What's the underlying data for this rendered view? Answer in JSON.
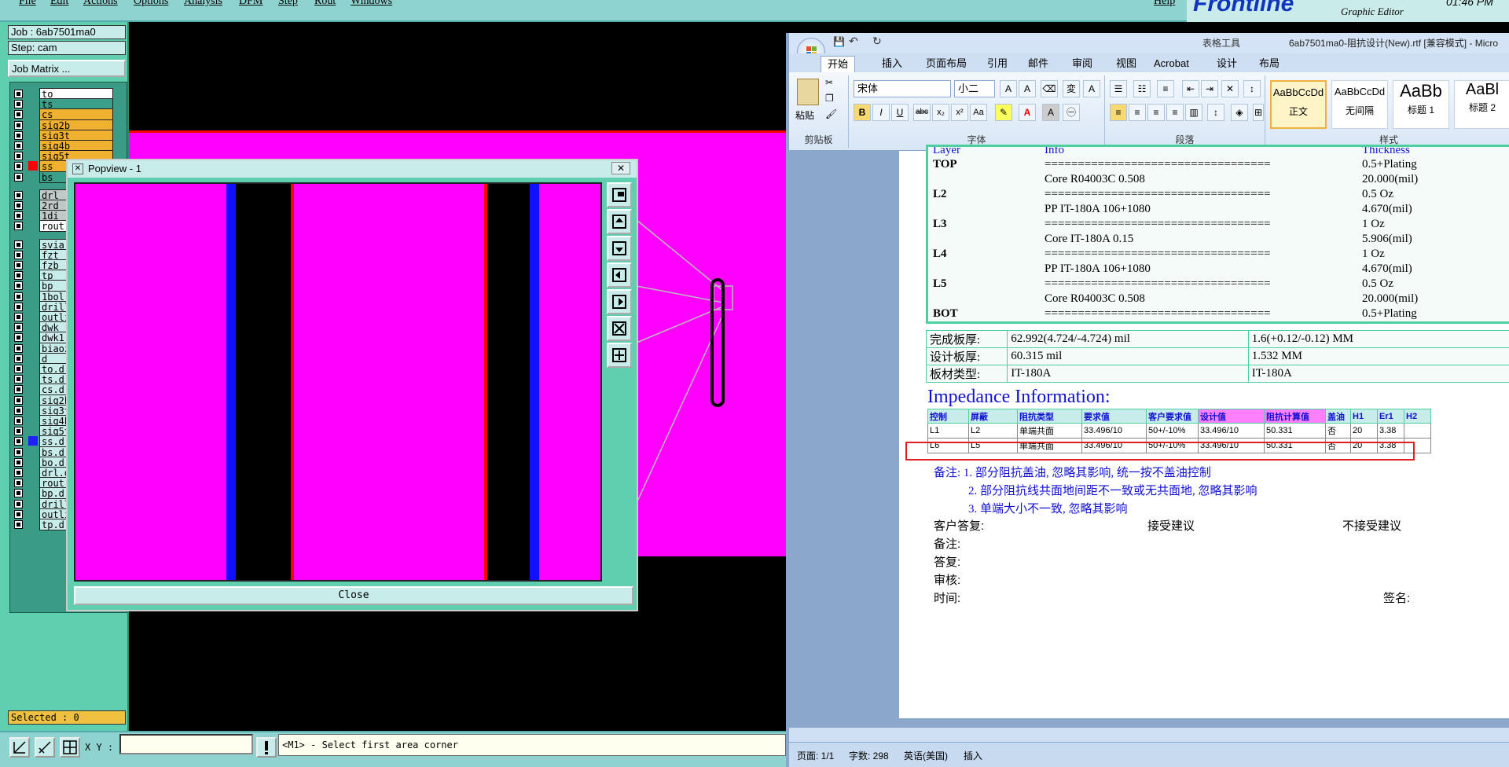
{
  "genesis": {
    "menu": [
      "File",
      "Edit",
      "Actions",
      "Options",
      "Analysis",
      "DFM",
      "Step",
      "Rout",
      "Windows",
      "Help"
    ],
    "job": "Job : 6ab7501ma0",
    "step": "Step: cam",
    "job_matrix": "Job Matrix ...",
    "layers": [
      {
        "name": "to",
        "color": "#ffffff"
      },
      {
        "name": "ts",
        "color": "#3aa08a"
      },
      {
        "name": "cs",
        "color": "#f0b030"
      },
      {
        "name": "sig2b",
        "color": "#f0b030"
      },
      {
        "name": "sig3t",
        "color": "#f0b030"
      },
      {
        "name": "sig4b",
        "color": "#f0b030"
      },
      {
        "name": "sig5t",
        "color": "#f0b030"
      },
      {
        "name": "ss",
        "color": "#f0b030",
        "swatch": "#ff0000"
      },
      {
        "name": "bs",
        "color": "#3aa08a"
      },
      {
        "name": "drl",
        "color": "#c0c8c8"
      },
      {
        "name": "2rd",
        "color": "#c0c8c8"
      },
      {
        "name": "1di",
        "color": "#c0c8c8"
      },
      {
        "name": "rout",
        "color": "#ffffff"
      },
      {
        "name": "svia",
        "color": "#c7ecea"
      },
      {
        "name": "fzt",
        "color": "#c7ecea"
      },
      {
        "name": "fzb",
        "color": "#c7ecea"
      },
      {
        "name": "tp",
        "color": "#c7ecea"
      },
      {
        "name": "bp",
        "color": "#c7ecea"
      },
      {
        "name": "1bol",
        "color": "#c7ecea"
      },
      {
        "name": "drill",
        "color": "#c7ecea"
      },
      {
        "name": "outli",
        "color": "#c7ecea"
      },
      {
        "name": "dwk",
        "color": "#c7ecea"
      },
      {
        "name": "dwk1",
        "color": "#c7ecea"
      },
      {
        "name": "biaoz",
        "color": "#c7ecea"
      },
      {
        "name": "d",
        "color": "#c7ecea"
      },
      {
        "name": "to.d",
        "color": "#c7ecea"
      },
      {
        "name": "ts.d",
        "color": "#c7ecea"
      },
      {
        "name": "cs.d",
        "color": "#c7ecea"
      },
      {
        "name": "sig2b",
        "color": "#c7ecea"
      },
      {
        "name": "sig3t",
        "color": "#c7ecea"
      },
      {
        "name": "sig4b",
        "color": "#c7ecea"
      },
      {
        "name": "sig5t",
        "color": "#c7ecea"
      },
      {
        "name": "ss.d",
        "color": "#c7ecea",
        "swatch": "#2020ff"
      },
      {
        "name": "bs.d",
        "color": "#c7ecea"
      },
      {
        "name": "bo.d",
        "color": "#c7ecea"
      },
      {
        "name": "drl.d",
        "color": "#c7ecea"
      },
      {
        "name": "rout.",
        "color": "#c7ecea"
      },
      {
        "name": "bp.d",
        "color": "#c7ecea"
      },
      {
        "name": "drill",
        "color": "#c7ecea"
      },
      {
        "name": "outli",
        "color": "#c7ecea"
      },
      {
        "name": "tp.d",
        "color": "#c7ecea"
      }
    ],
    "selected": "Selected : 0",
    "xy_label": "X Y :",
    "message": "<M1> - Select first area corner",
    "popview_title": "Popview - 1",
    "popview_close": "Close"
  },
  "frontline": {
    "logo": "Frontline",
    "subtitle": "Graphic Editor",
    "time": "01:46 PM"
  },
  "word": {
    "title": "6ab7501ma0-阻抗设计(New).rtf [兼容模式] - Micro",
    "context_tab": "表格工具",
    "tabs": [
      "开始",
      "插入",
      "页面布局",
      "引用",
      "邮件",
      "审阅",
      "视图",
      "Acrobat",
      "设计",
      "布局"
    ],
    "font_name": "宋体",
    "font_size": "小二",
    "paste_label": "粘贴",
    "groups": [
      "剪贴板",
      "字体",
      "段落",
      "样式"
    ],
    "styles": [
      {
        "preview": "AaBbCcDd",
        "label": "正文"
      },
      {
        "preview": "AaBbCcDd",
        "label": "无间隔"
      },
      {
        "preview": "AaBb",
        "label": "标题 1"
      },
      {
        "preview": "AaBl",
        "label": "标题 2"
      }
    ],
    "stack": {
      "header": [
        "Layer",
        "Info",
        "Thickness"
      ],
      "rows": [
        [
          "TOP",
          "==================================",
          "0.5+Plating"
        ],
        [
          "",
          "Core      R04003C    0.508",
          "20.000(mil)"
        ],
        [
          "L2",
          "==================================",
          "0.5 Oz"
        ],
        [
          "",
          "PP      IT-180A    106+1080",
          "4.670(mil)"
        ],
        [
          "L3",
          "==================================",
          "1 Oz"
        ],
        [
          "",
          "Core      IT-180A    0.15",
          "5.906(mil)"
        ],
        [
          "L4",
          "==================================",
          "1 Oz"
        ],
        [
          "",
          "PP      IT-180A    106+1080",
          "4.670(mil)"
        ],
        [
          "L5",
          "==================================",
          "0.5 Oz"
        ],
        [
          "",
          "Core      R04003C    0.508",
          "20.000(mil)"
        ],
        [
          "BOT",
          "==================================",
          "0.5+Plating"
        ]
      ]
    },
    "thickness": [
      [
        "完成板厚:",
        "62.992(4.724/-4.724) mil",
        "1.6(+0.12/-0.12) MM"
      ],
      [
        "设计板厚:",
        "60.315 mil",
        "1.532 MM"
      ],
      [
        "板材类型:",
        "IT-180A",
        "IT-180A"
      ]
    ],
    "impedance_title": "Impedance Information:",
    "imp_header": [
      "控制",
      "屏蔽",
      "阻抗类型",
      "要求值",
      "客户要求值",
      "设计值",
      "阻抗计算值",
      "盖油",
      "H1",
      "Er1",
      "H2"
    ],
    "imp_rows": [
      [
        "L1",
        "L2",
        "单端共面",
        "33.496/10",
        "50+/-10%",
        "33.496/10",
        "50.331",
        "否",
        "20",
        "3.38",
        ""
      ],
      [
        "L6",
        "L5",
        "单端共面",
        "33.496/10",
        "50+/-10%",
        "33.496/10",
        "50.331",
        "否",
        "20",
        "3.38",
        ""
      ]
    ],
    "notes": [
      "备注: 1. 部分阻抗盖油, 忽略其影响, 统一按不盖油控制",
      "2. 部分阻抗线共面地间距不一致或无共面地, 忽略其影响",
      "3. 单端大小不一致, 忽略其影响"
    ],
    "customer_reply": "客户答复:",
    "accept": "接受建议",
    "reject": "不接受建议",
    "remark": "备注:",
    "reply": "答复:",
    "review": "审核:",
    "time": "时间:",
    "sign": "签名:",
    "status_page": "页面: 1/1",
    "status_words": "字数: 298",
    "status_lang": "英语(美国)",
    "status_insert": "插入"
  }
}
